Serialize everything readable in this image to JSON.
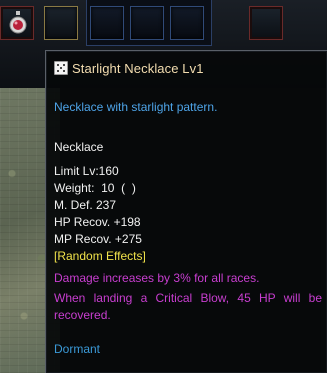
{
  "inventory": {
    "slots": [
      "amulet-slot",
      "empty-slot",
      "quick-slot-1",
      "quick-slot-2",
      "quick-slot-3",
      "quick-slot-4"
    ]
  },
  "tooltip": {
    "icon": "dice-icon",
    "name": "Starlight Necklace Lv1",
    "description": "Necklace with starlight pattern.",
    "category": "Necklace",
    "stats": {
      "limit": "Limit Lv:160",
      "weight": "Weight:  10  (  )",
      "mdef": "M. Def. 237",
      "hp_recov": "HP Recov. +198",
      "mp_recov": "MP Recov. +275"
    },
    "random_effects": {
      "header": "[Random Effects]",
      "effect1": "Damage increases by 3% for all races.",
      "effect2_line1": "When landing a Critical Blow, 45 HP will be",
      "effect2_line2": "recovered."
    },
    "status": "Dormant"
  },
  "colors": {
    "item_name": "#f3ddb0",
    "description": "#4ea4e8",
    "stat_text": "#f1f1f1",
    "random_effects_header": "#f0e24a",
    "random_effect_text": "#c83ed0",
    "status_text": "#3b9ad8"
  }
}
